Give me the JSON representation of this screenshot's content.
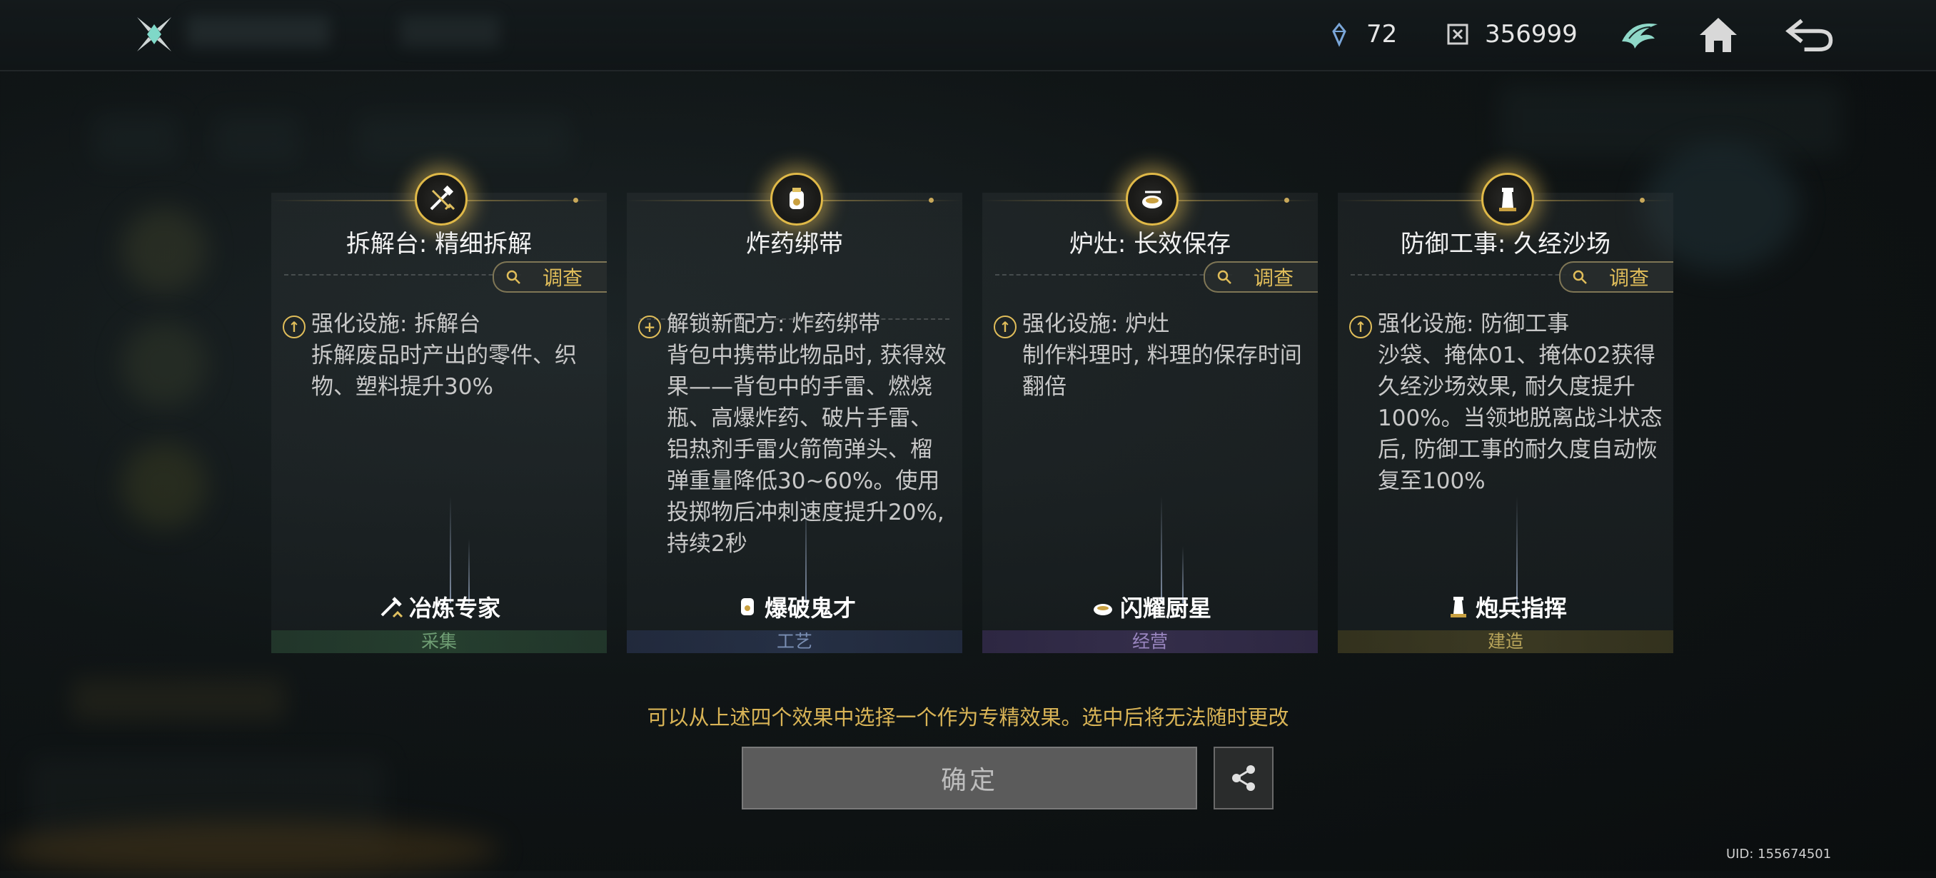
{
  "topbar": {
    "currency1_value": "72",
    "currency2_value": "356999",
    "icons": [
      "app-logo-icon",
      "crystal-currency-icon",
      "puzzle-currency-icon",
      "faction-emblem-icon",
      "home-icon",
      "back-icon"
    ]
  },
  "cards": [
    {
      "title": "拆解台: 精细拆解",
      "inspect_label": "调查",
      "effect_type": "强化设施: 拆解台",
      "description": "拆解废品时产出的零件、织物、塑料提升30%",
      "skill_name": "冶炼专家",
      "category": "采集",
      "category_color": "#6f9e74",
      "icon": "hammer-wrench-icon"
    },
    {
      "title": "炸药绑带",
      "inspect_label": "",
      "effect_type": "解锁新配方: 炸药绑带",
      "description": "背包中携带此物品时, 获得效果——背包中的手雷、燃烧瓶、高爆炸药、破片手雷、铝热剂手雷火箭筒弹头、榴弹重量降低30~60%。使用投掷物后冲刺速度提升20%, 持续2秒",
      "skill_name": "爆破鬼才",
      "category": "工艺",
      "category_color": "#7a8fb4",
      "icon": "explosive-belt-icon"
    },
    {
      "title": "炉灶: 长效保存",
      "inspect_label": "调查",
      "effect_type": "强化设施: 炉灶",
      "description": "制作料理时, 料理的保存时间翻倍",
      "skill_name": "闪耀厨星",
      "category": "经营",
      "category_color": "#9a86c0",
      "icon": "cooking-pot-icon"
    },
    {
      "title": "防御工事: 久经沙场",
      "inspect_label": "调查",
      "effect_type": "强化设施: 防御工事",
      "description": "沙袋、掩体01、掩体02获得久经沙场效果, 耐久度提升100%。当领地脱离战斗状态后, 防御工事的耐久度自动恢复至100%",
      "skill_name": "炮兵指挥",
      "category": "建造",
      "category_color": "#b8a45a",
      "icon": "watchtower-icon"
    }
  ],
  "hint": "可以从上述四个效果中选择一个作为专精效果。选中后将无法随时更改",
  "confirm_label": "确定",
  "uid": "UID: 155674501"
}
